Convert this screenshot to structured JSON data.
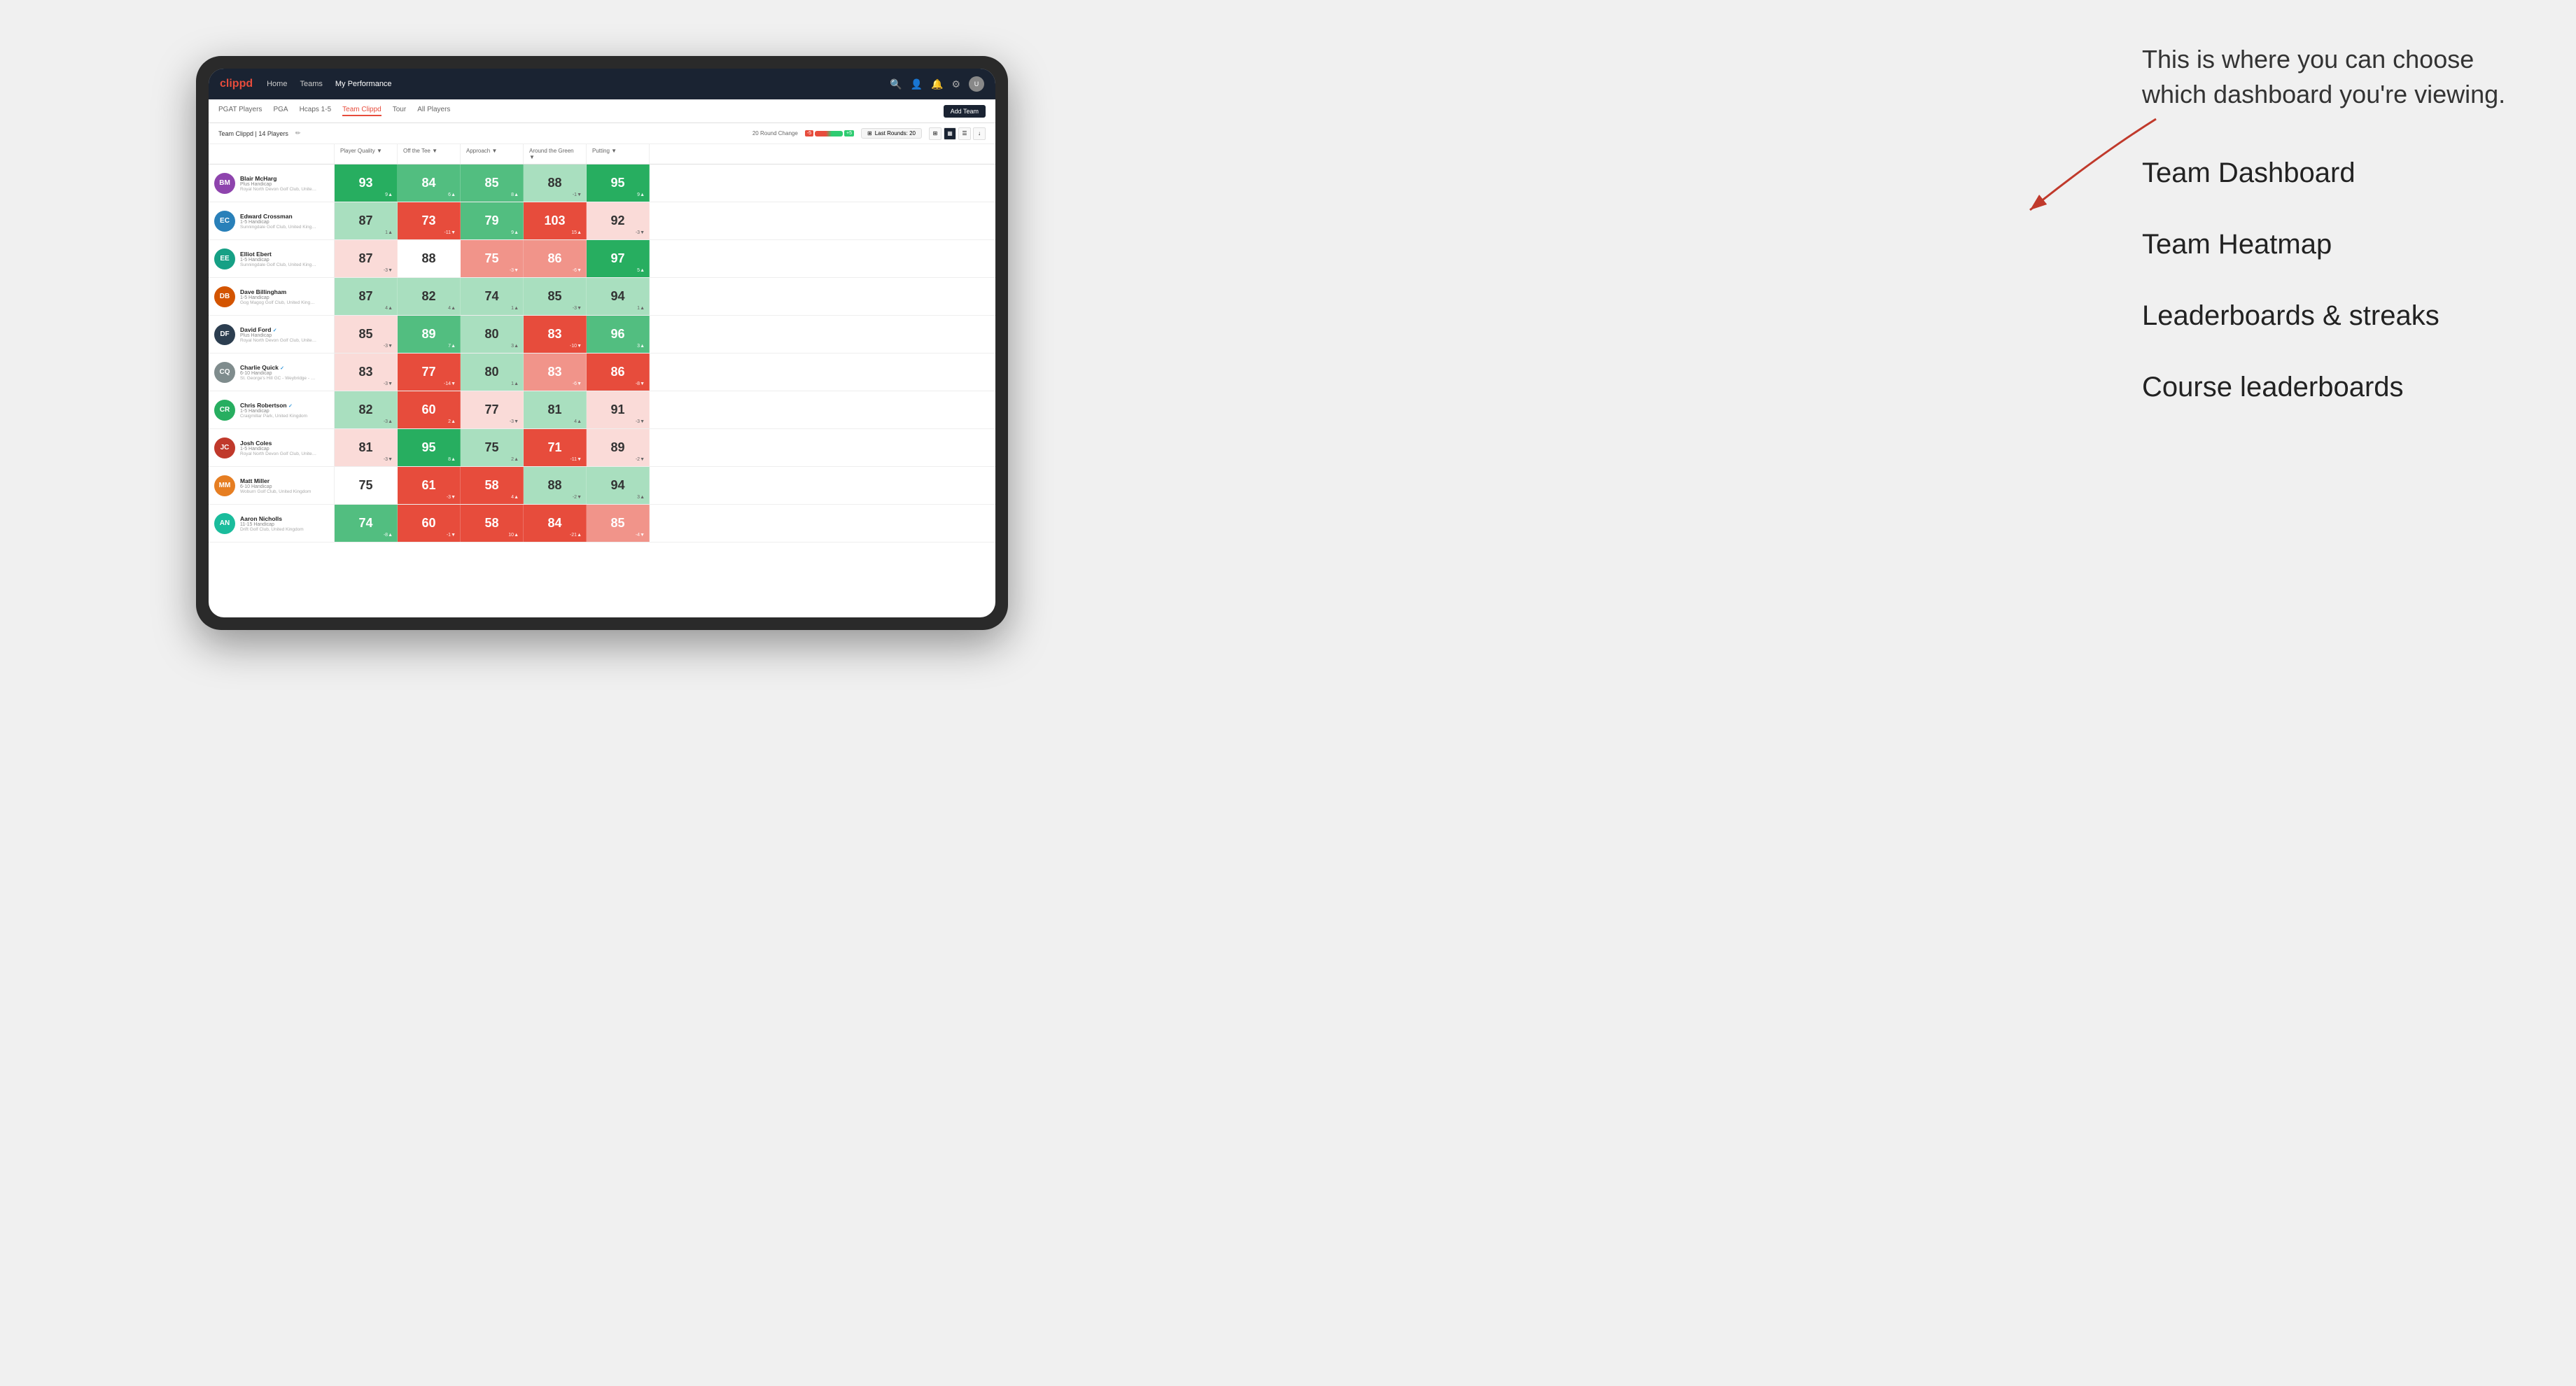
{
  "annotation": {
    "intro": "This is where you can choose which dashboard you're viewing.",
    "menu_items": [
      "Team Dashboard",
      "Team Heatmap",
      "Leaderboards & streaks",
      "Course leaderboards"
    ]
  },
  "nav": {
    "logo": "clippd",
    "links": [
      "Home",
      "Teams",
      "My Performance"
    ],
    "active_link": "My Performance"
  },
  "tabs": {
    "items": [
      "PGAT Players",
      "PGA",
      "Hcaps 1-5",
      "Team Clippd",
      "Tour",
      "All Players"
    ],
    "active": "Team Clippd",
    "add_button": "Add Team"
  },
  "sub_header": {
    "team_name": "Team Clippd",
    "player_count": "14 Players",
    "round_change_label": "20 Round Change",
    "change_neg": "-5",
    "change_pos": "+5",
    "last_rounds_label": "Last Rounds:",
    "last_rounds_value": "20"
  },
  "table": {
    "columns": [
      "Player Quality ▼",
      "Off the Tee ▼",
      "Approach ▼",
      "Around the Green ▼",
      "Putting ▼"
    ],
    "players": [
      {
        "name": "Blair McHarg",
        "handicap": "Plus Handicap",
        "club": "Royal North Devon Golf Club, United Kingdom",
        "verified": false,
        "stats": [
          {
            "value": "93",
            "change": "9▲",
            "bg": "green-strong"
          },
          {
            "value": "84",
            "change": "6▲",
            "bg": "green-medium"
          },
          {
            "value": "85",
            "change": "8▲",
            "bg": "green-medium"
          },
          {
            "value": "88",
            "change": "-1▼",
            "bg": "green-light"
          },
          {
            "value": "95",
            "change": "9▲",
            "bg": "green-strong"
          }
        ]
      },
      {
        "name": "Edward Crossman",
        "handicap": "1-5 Handicap",
        "club": "Sunningdale Golf Club, United Kingdom",
        "verified": false,
        "stats": [
          {
            "value": "87",
            "change": "1▲",
            "bg": "green-light"
          },
          {
            "value": "73",
            "change": "-11▼",
            "bg": "red-strong"
          },
          {
            "value": "79",
            "change": "9▲",
            "bg": "green-medium"
          },
          {
            "value": "103",
            "change": "15▲",
            "bg": "red-strong"
          },
          {
            "value": "92",
            "change": "-3▼",
            "bg": "red-light"
          }
        ]
      },
      {
        "name": "Elliot Ebert",
        "handicap": "1-5 Handicap",
        "club": "Sunningdale Golf Club, United Kingdom",
        "verified": false,
        "stats": [
          {
            "value": "87",
            "change": "-3▼",
            "bg": "red-light"
          },
          {
            "value": "88",
            "change": "",
            "bg": "white"
          },
          {
            "value": "75",
            "change": "-3▼",
            "bg": "red-medium"
          },
          {
            "value": "86",
            "change": "-6▼",
            "bg": "red-medium"
          },
          {
            "value": "97",
            "change": "5▲",
            "bg": "green-strong"
          }
        ]
      },
      {
        "name": "Dave Billingham",
        "handicap": "1-5 Handicap",
        "club": "Gog Magog Golf Club, United Kingdom",
        "verified": false,
        "stats": [
          {
            "value": "87",
            "change": "4▲",
            "bg": "green-light"
          },
          {
            "value": "82",
            "change": "4▲",
            "bg": "green-light"
          },
          {
            "value": "74",
            "change": "1▲",
            "bg": "green-light"
          },
          {
            "value": "85",
            "change": "-3▼",
            "bg": "green-light"
          },
          {
            "value": "94",
            "change": "1▲",
            "bg": "green-light"
          }
        ]
      },
      {
        "name": "David Ford",
        "handicap": "Plus Handicap",
        "club": "Royal North Devon Golf Club, United Kingdom",
        "verified": true,
        "stats": [
          {
            "value": "85",
            "change": "-3▼",
            "bg": "red-light"
          },
          {
            "value": "89",
            "change": "7▲",
            "bg": "green-medium"
          },
          {
            "value": "80",
            "change": "3▲",
            "bg": "green-light"
          },
          {
            "value": "83",
            "change": "-10▼",
            "bg": "red-strong"
          },
          {
            "value": "96",
            "change": "3▲",
            "bg": "green-medium"
          }
        ]
      },
      {
        "name": "Charlie Quick",
        "handicap": "6-10 Handicap",
        "club": "St. George's Hill GC - Weybridge - Surrey, Uni...",
        "verified": true,
        "stats": [
          {
            "value": "83",
            "change": "-3▼",
            "bg": "red-light"
          },
          {
            "value": "77",
            "change": "-14▼",
            "bg": "red-strong"
          },
          {
            "value": "80",
            "change": "1▲",
            "bg": "green-light"
          },
          {
            "value": "83",
            "change": "-6▼",
            "bg": "red-medium"
          },
          {
            "value": "86",
            "change": "-8▼",
            "bg": "red-strong"
          }
        ]
      },
      {
        "name": "Chris Robertson",
        "handicap": "1-5 Handicap",
        "club": "Craigmillar Park, United Kingdom",
        "verified": true,
        "stats": [
          {
            "value": "82",
            "change": "-3▲",
            "bg": "green-light"
          },
          {
            "value": "60",
            "change": "2▲",
            "bg": "red-strong"
          },
          {
            "value": "77",
            "change": "-3▼",
            "bg": "red-light"
          },
          {
            "value": "81",
            "change": "4▲",
            "bg": "green-light"
          },
          {
            "value": "91",
            "change": "-3▼",
            "bg": "red-light"
          }
        ]
      },
      {
        "name": "Josh Coles",
        "handicap": "1-5 Handicap",
        "club": "Royal North Devon Golf Club, United Kingdom",
        "verified": false,
        "stats": [
          {
            "value": "81",
            "change": "-3▼",
            "bg": "red-light"
          },
          {
            "value": "95",
            "change": "8▲",
            "bg": "green-strong"
          },
          {
            "value": "75",
            "change": "2▲",
            "bg": "green-light"
          },
          {
            "value": "71",
            "change": "-11▼",
            "bg": "red-strong"
          },
          {
            "value": "89",
            "change": "-2▼",
            "bg": "red-light"
          }
        ]
      },
      {
        "name": "Matt Miller",
        "handicap": "6-10 Handicap",
        "club": "Woburn Golf Club, United Kingdom",
        "verified": false,
        "stats": [
          {
            "value": "75",
            "change": "",
            "bg": "white"
          },
          {
            "value": "61",
            "change": "-3▼",
            "bg": "red-strong"
          },
          {
            "value": "58",
            "change": "4▲",
            "bg": "red-strong"
          },
          {
            "value": "88",
            "change": "-2▼",
            "bg": "green-light"
          },
          {
            "value": "94",
            "change": "3▲",
            "bg": "green-light"
          }
        ]
      },
      {
        "name": "Aaron Nicholls",
        "handicap": "11-15 Handicap",
        "club": "Drift Golf Club, United Kingdom",
        "verified": false,
        "stats": [
          {
            "value": "74",
            "change": "-8▲",
            "bg": "green-medium"
          },
          {
            "value": "60",
            "change": "-1▼",
            "bg": "red-strong"
          },
          {
            "value": "58",
            "change": "10▲",
            "bg": "red-strong"
          },
          {
            "value": "84",
            "change": "-21▲",
            "bg": "red-strong"
          },
          {
            "value": "85",
            "change": "-4▼",
            "bg": "red-medium"
          }
        ]
      }
    ]
  }
}
